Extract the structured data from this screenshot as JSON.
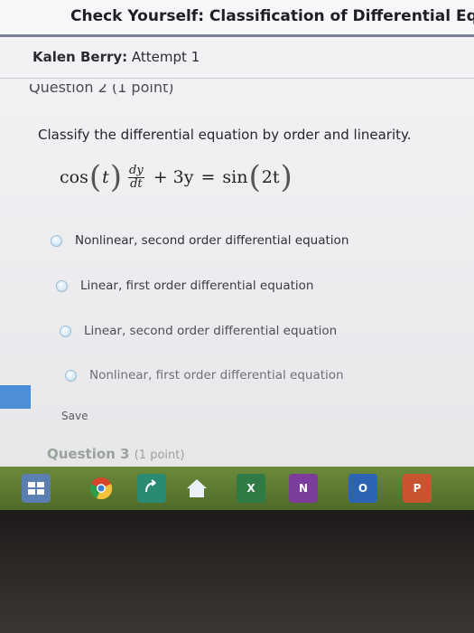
{
  "header": {
    "title": "Check Yourself: Classification of Differential Equatio"
  },
  "student": {
    "name": "Kalen Berry:",
    "attempt": "Attempt 1"
  },
  "question": {
    "header": "Question 2 (1 point)",
    "prompt": "Classify the differential equation by order and linearity.",
    "equation": {
      "cos": "cos",
      "t": "t",
      "dy": "dy",
      "dt": "dt",
      "plus_3y": "+ 3y",
      "equals": "=",
      "sin": "sin",
      "two_t": "2t"
    },
    "options": [
      {
        "label": "Nonlinear, second order differential equation"
      },
      {
        "label": "Linear, first order differential equation"
      },
      {
        "label": "Linear, second order differential equation"
      },
      {
        "label": "Nonlinear, first order differential equation"
      }
    ],
    "save_label": "Save"
  },
  "next_question": {
    "label": "Question 3",
    "points": "(1 point)"
  },
  "taskbar": {
    "items": [
      {
        "icon": "start-icon"
      },
      {
        "icon": "chrome-icon"
      },
      {
        "icon": "sharing-icon"
      },
      {
        "icon": "home-icon"
      },
      {
        "icon": "excel-icon",
        "text": "X"
      },
      {
        "icon": "onenote-icon",
        "text": "N"
      },
      {
        "icon": "outlook-icon",
        "text": "O"
      },
      {
        "icon": "powerpoint-icon",
        "text": "P"
      }
    ]
  }
}
